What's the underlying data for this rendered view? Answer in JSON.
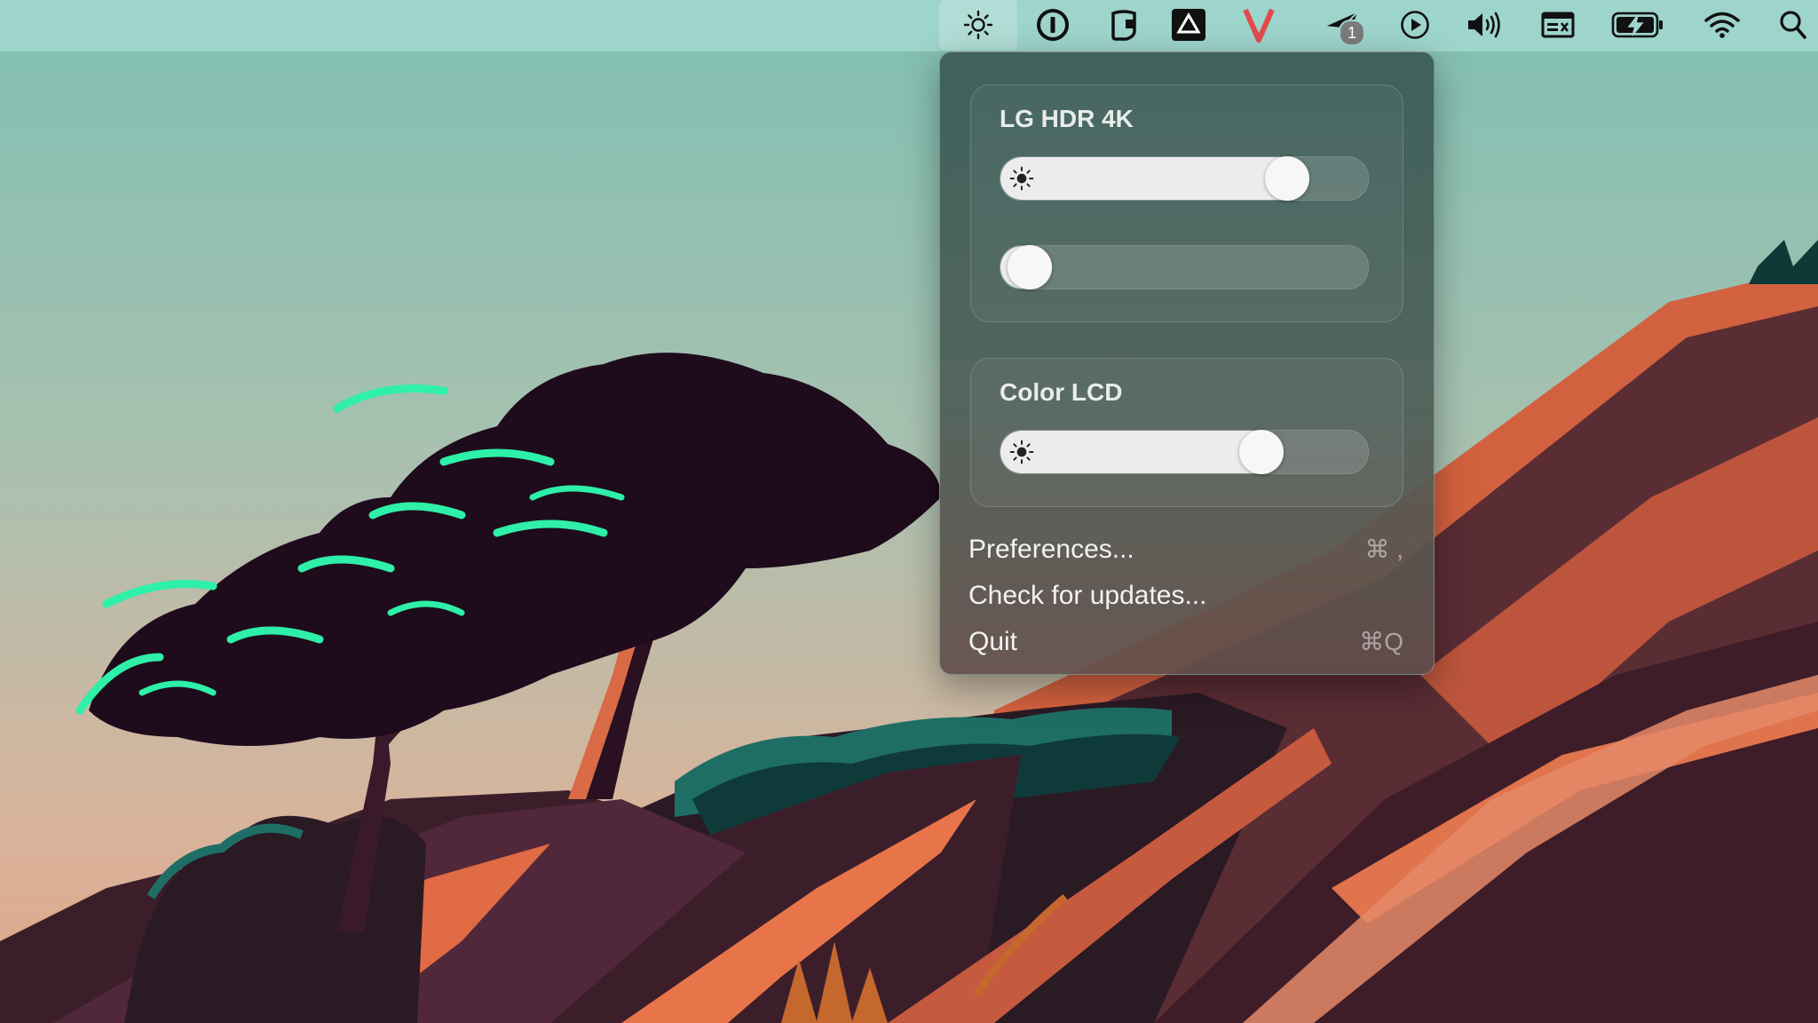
{
  "menubar": {
    "items": [
      {
        "name": "brightness-icon"
      },
      {
        "name": "1password-icon"
      },
      {
        "name": "clipboard-icon"
      },
      {
        "name": "drive-icon"
      },
      {
        "name": "v-app-icon",
        "color": "#e24a4a"
      },
      {
        "name": "send-icon",
        "badge": "1"
      },
      {
        "name": "play-icon"
      },
      {
        "name": "volume-icon"
      },
      {
        "name": "window-icon"
      },
      {
        "name": "battery-charging-icon"
      },
      {
        "name": "wifi-icon"
      },
      {
        "name": "search-icon"
      }
    ]
  },
  "panel": {
    "displays": [
      {
        "title": "LG HDR 4K",
        "brightness": 0.78,
        "volume": 0.08
      },
      {
        "title": "Color LCD",
        "brightness": 0.71
      }
    ],
    "menu": [
      {
        "label": "Preferences...",
        "shortcut": "⌘ ,"
      },
      {
        "label": "Check for updates...",
        "shortcut": ""
      },
      {
        "label": "Quit",
        "shortcut": "⌘Q"
      }
    ]
  },
  "colors": {
    "menubar": "#a0d6cd",
    "slider_fill": "#ececec",
    "panel": "#3a5c56"
  }
}
